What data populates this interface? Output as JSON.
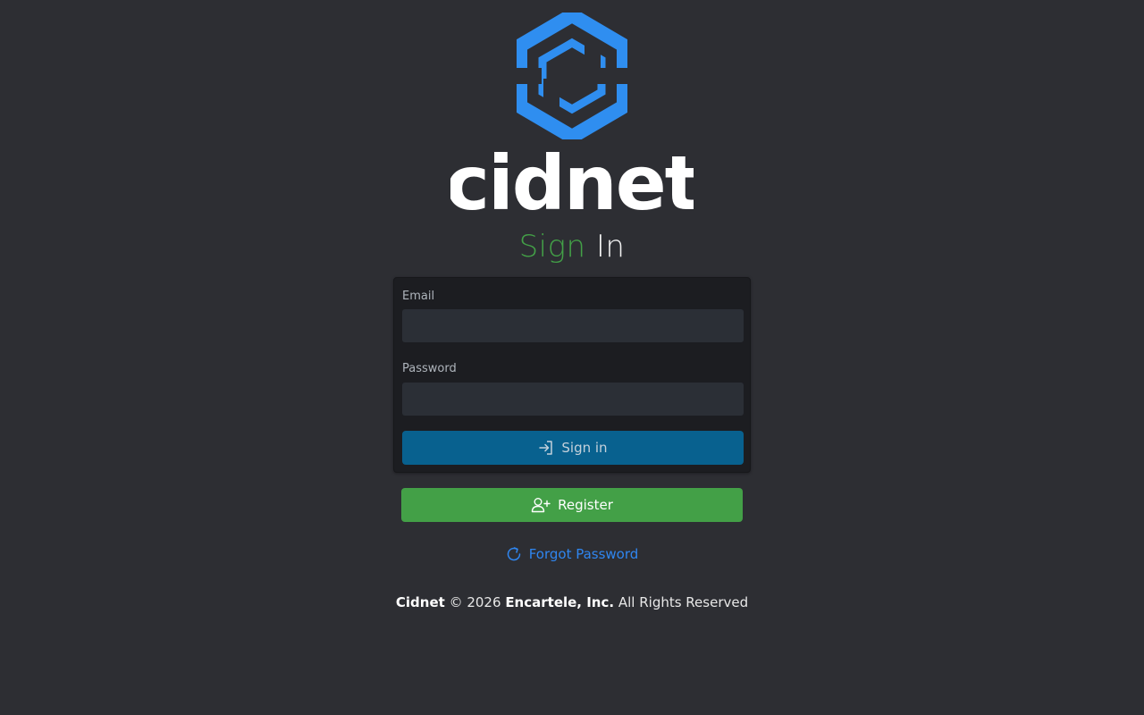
{
  "brand": {
    "name": "cidnet",
    "mark_icon": "hexagon-c-logo-icon",
    "mark_color": "#2f8ef0",
    "word_color": "#ffffff"
  },
  "title": {
    "word1": "Sign",
    "word2": "In",
    "word1_color": "#43a047",
    "word2_color": "#f1f1f1"
  },
  "form": {
    "email_label": "Email",
    "email_value": "",
    "email_placeholder": "",
    "password_label": "Password",
    "password_value": "",
    "password_placeholder": "",
    "signin_label": "Sign in",
    "signin_icon": "sign-in-arrow-icon",
    "signin_color": "#08618f"
  },
  "register": {
    "label": "Register",
    "icon": "user-plus-icon",
    "color": "#43a047"
  },
  "forgot": {
    "label": "Forgot Password",
    "icon": "refresh-icon",
    "color": "#2f86f0"
  },
  "footer": {
    "company": "Cidnet",
    "copyright": "© 2026",
    "owner": "Encartele, Inc.",
    "rights": "All Rights Reserved"
  }
}
